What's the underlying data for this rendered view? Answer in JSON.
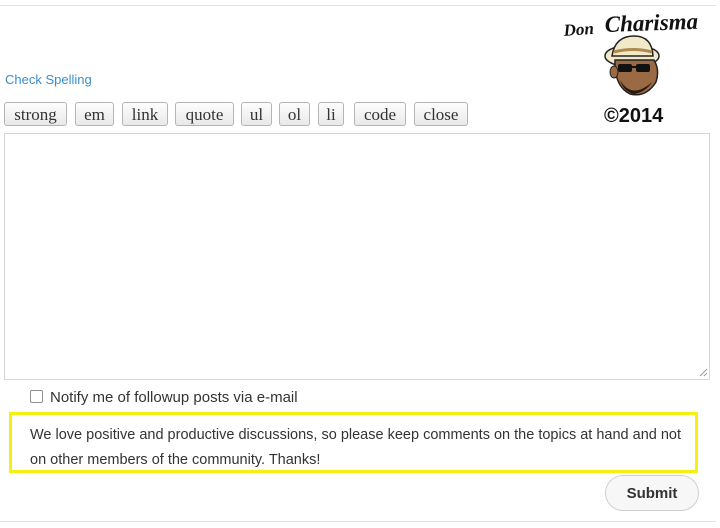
{
  "editor": {
    "check_spelling": "Check Spelling",
    "quicktags": [
      {
        "label": "strong"
      },
      {
        "label": "em"
      },
      {
        "label": "link"
      },
      {
        "label": "quote"
      },
      {
        "label": "ul"
      },
      {
        "label": "ol"
      },
      {
        "label": "li"
      },
      {
        "label": "code"
      },
      {
        "label": "close"
      }
    ],
    "comment_value": ""
  },
  "notify": {
    "label": "Notify me of followup posts via e-mail",
    "checked": false
  },
  "notice": {
    "text": "We love positive and productive discussions, so please keep comments on the topics at hand and not on other members of the community. Thanks!",
    "border_color": "#f5ef13"
  },
  "submit": {
    "label": "Submit"
  },
  "logo": {
    "title": "Don Charisma",
    "copyright": "©2014",
    "icon": "cartoon-face-logo"
  },
  "colors": {
    "link": "#3a8fcf",
    "highlight_border": "#f5ef13"
  }
}
